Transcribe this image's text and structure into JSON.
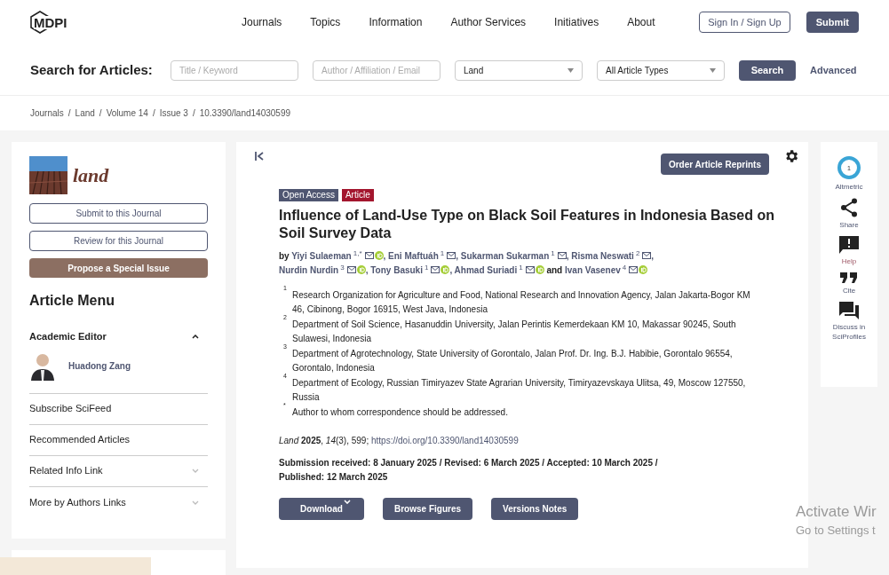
{
  "nav": {
    "logo": "MDPI",
    "links": [
      "Journals",
      "Topics",
      "Information",
      "Author Services",
      "Initiatives",
      "About"
    ],
    "sign_in": "Sign In / Sign Up",
    "submit": "Submit"
  },
  "search": {
    "label": "Search for Articles:",
    "fields": [
      {
        "kind": "text",
        "placeholder": "Title / Keyword"
      },
      {
        "kind": "text",
        "placeholder": "Author / Affiliation / Email"
      },
      {
        "kind": "select",
        "value": "Land"
      },
      {
        "kind": "select",
        "value": "All Article Types"
      }
    ],
    "button": "Search",
    "advanced": "Advanced"
  },
  "breadcrumbs": {
    "separator": "/",
    "items": [
      "Journals",
      "Land",
      "Volume 14",
      "Issue 3",
      "10.3390/land14030599"
    ]
  },
  "sidebar": {
    "journal_name": "land",
    "buttons": [
      {
        "label": "Submit to this Journal",
        "kind": "outline"
      },
      {
        "label": "Review for this Journal",
        "kind": "outline"
      },
      {
        "label": "Propose a Special Issue",
        "kind": "filled"
      }
    ],
    "menu_title": "Article Menu",
    "editor_heading": "Academic Editor",
    "editor_expanded": true,
    "editor_name": "Huadong Zang",
    "items": [
      {
        "label": "Subscribe SciFeed",
        "expandable": false
      },
      {
        "label": "Recommended Articles",
        "expandable": false
      },
      {
        "label": "Related Info Link",
        "expandable": true
      },
      {
        "label": "More by Authors Links",
        "expandable": true
      }
    ]
  },
  "article": {
    "reprints": "Order Article Reprints",
    "badges": [
      {
        "label": "Open Access",
        "color": "#4f5671"
      },
      {
        "label": "Article",
        "color": "#a3162e"
      }
    ],
    "title": "Influence of Land-Use Type on Black Soil Features in Indonesia Based on Soil Survey Data",
    "authors": [
      {
        "prefix": "by",
        "name": "Yiyi Sulaeman",
        "sup": "1,*",
        "orcid": true
      },
      {
        "prefix": ",",
        "name": "Eni Maftuáh",
        "sup": "1",
        "orcid": false
      },
      {
        "prefix": ",",
        "name": "Sukarman Sukarman",
        "sup": "1",
        "orcid": false
      },
      {
        "prefix": ",",
        "name": "Risma Neswati",
        "sup": "2",
        "orcid": false
      },
      {
        "prefix": ",",
        "name": "Nurdin Nurdin",
        "sup": "3",
        "orcid": true
      },
      {
        "prefix": ",",
        "name": "Tony Basuki",
        "sup": "1",
        "orcid": true
      },
      {
        "prefix": ",",
        "name": "Ahmad Suriadi",
        "sup": "1",
        "orcid": true
      },
      {
        "prefix": "and",
        "name": "Ivan Vasenev",
        "sup": "4",
        "orcid": true
      }
    ],
    "affiliations": [
      {
        "mark": "1",
        "text": "Research Organization for Agriculture and Food, National Research and Innovation Agency, Jalan Jakarta-Bogor KM 46, Cibinong, Bogor 16915, West Java, Indonesia"
      },
      {
        "mark": "2",
        "text": "Department of Soil Science, Hasanuddin University, Jalan Perintis Kemerdekaan KM 10, Makassar 90245, South Sulawesi, Indonesia"
      },
      {
        "mark": "3",
        "text": "Department of Agrotechnology, State University of Gorontalo, Jalan Prof. Dr. Ing. B.J. Habibie, Gorontalo 96554, Gorontalo, Indonesia"
      },
      {
        "mark": "4",
        "text": "Department of Ecology, Russian Timiryazev State Agrarian University, Timiryazevskaya Ulitsa, 49, Moscow 127550, Russia"
      },
      {
        "mark": "*",
        "text": "Author to whom correspondence should be addressed."
      }
    ],
    "citation": "*Land* **2025**, *14*(3), 599;",
    "doi": "https://doi.org/10.3390/land14030599",
    "dates": "Submission received: 8 January 2025 / Revised: 6 March 2025 / Accepted: 10 March 2025 / Published: 12 March 2025",
    "actions": [
      {
        "label": "Download",
        "dropdown": true
      },
      {
        "label": "Browse Figures",
        "dropdown": false
      },
      {
        "label": "Versions Notes",
        "dropdown": false
      }
    ]
  },
  "tools": [
    {
      "kind": "altmetric",
      "label": "Altmetric",
      "count": "1"
    },
    {
      "kind": "share",
      "label": "Share"
    },
    {
      "kind": "help",
      "label": "Help"
    },
    {
      "kind": "cite",
      "label": "Cite"
    },
    {
      "kind": "discuss",
      "label": "Discuss in SciProfiles"
    }
  ],
  "os_overlay": {
    "title": "Activate Wir",
    "subtitle": "Go to Settings t"
  }
}
